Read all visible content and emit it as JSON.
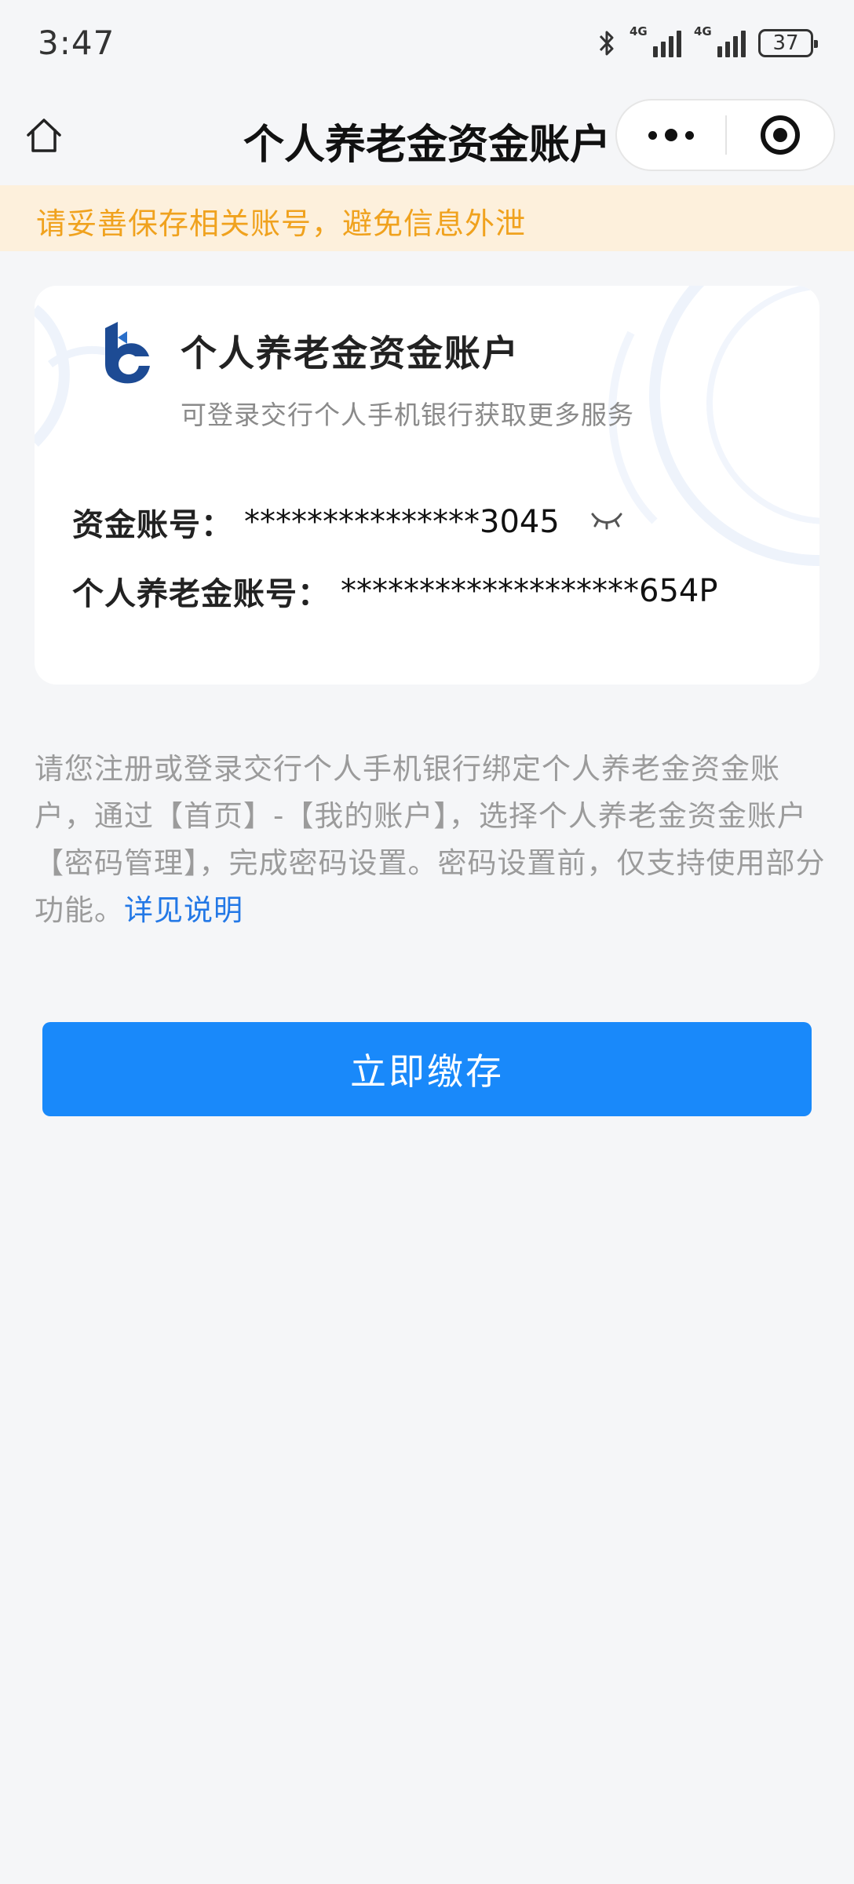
{
  "status_bar": {
    "time": "3:47",
    "signal_1_label": "4G",
    "signal_2_label": "4G",
    "battery": "37"
  },
  "nav": {
    "title": "个人养老金资金账户",
    "home_icon": "home-icon",
    "more_icon": "more-dots-icon",
    "close_icon": "target-close-icon"
  },
  "notice": {
    "text": "请妥善保存相关账号，避免信息外泄",
    "bg_color": "#fdf0dc",
    "text_color": "#f0a21e"
  },
  "card": {
    "logo_icon": "bank-logo-icon",
    "title": "个人养老金资金账户",
    "subtitle": "可登录交行个人手机银行获取更多服务",
    "fund_account": {
      "label": "资金账号：",
      "value": "***************3045",
      "toggle_icon": "eye-closed-icon"
    },
    "pension_account": {
      "label": "个人养老金账号：",
      "value": "*******************654P"
    }
  },
  "instructions": {
    "text": "请您注册或登录交行个人手机银行绑定个人养老金资金账户，通过【首页】-【我的账户】，选择个人养老金资金账户【密码管理】，完成密码设置。密码设置前，仅支持使用部分功能。",
    "link_text": "详见说明",
    "link_color": "#2378e6"
  },
  "primary_button": {
    "label": "立即缴存",
    "color": "#1989fa"
  }
}
